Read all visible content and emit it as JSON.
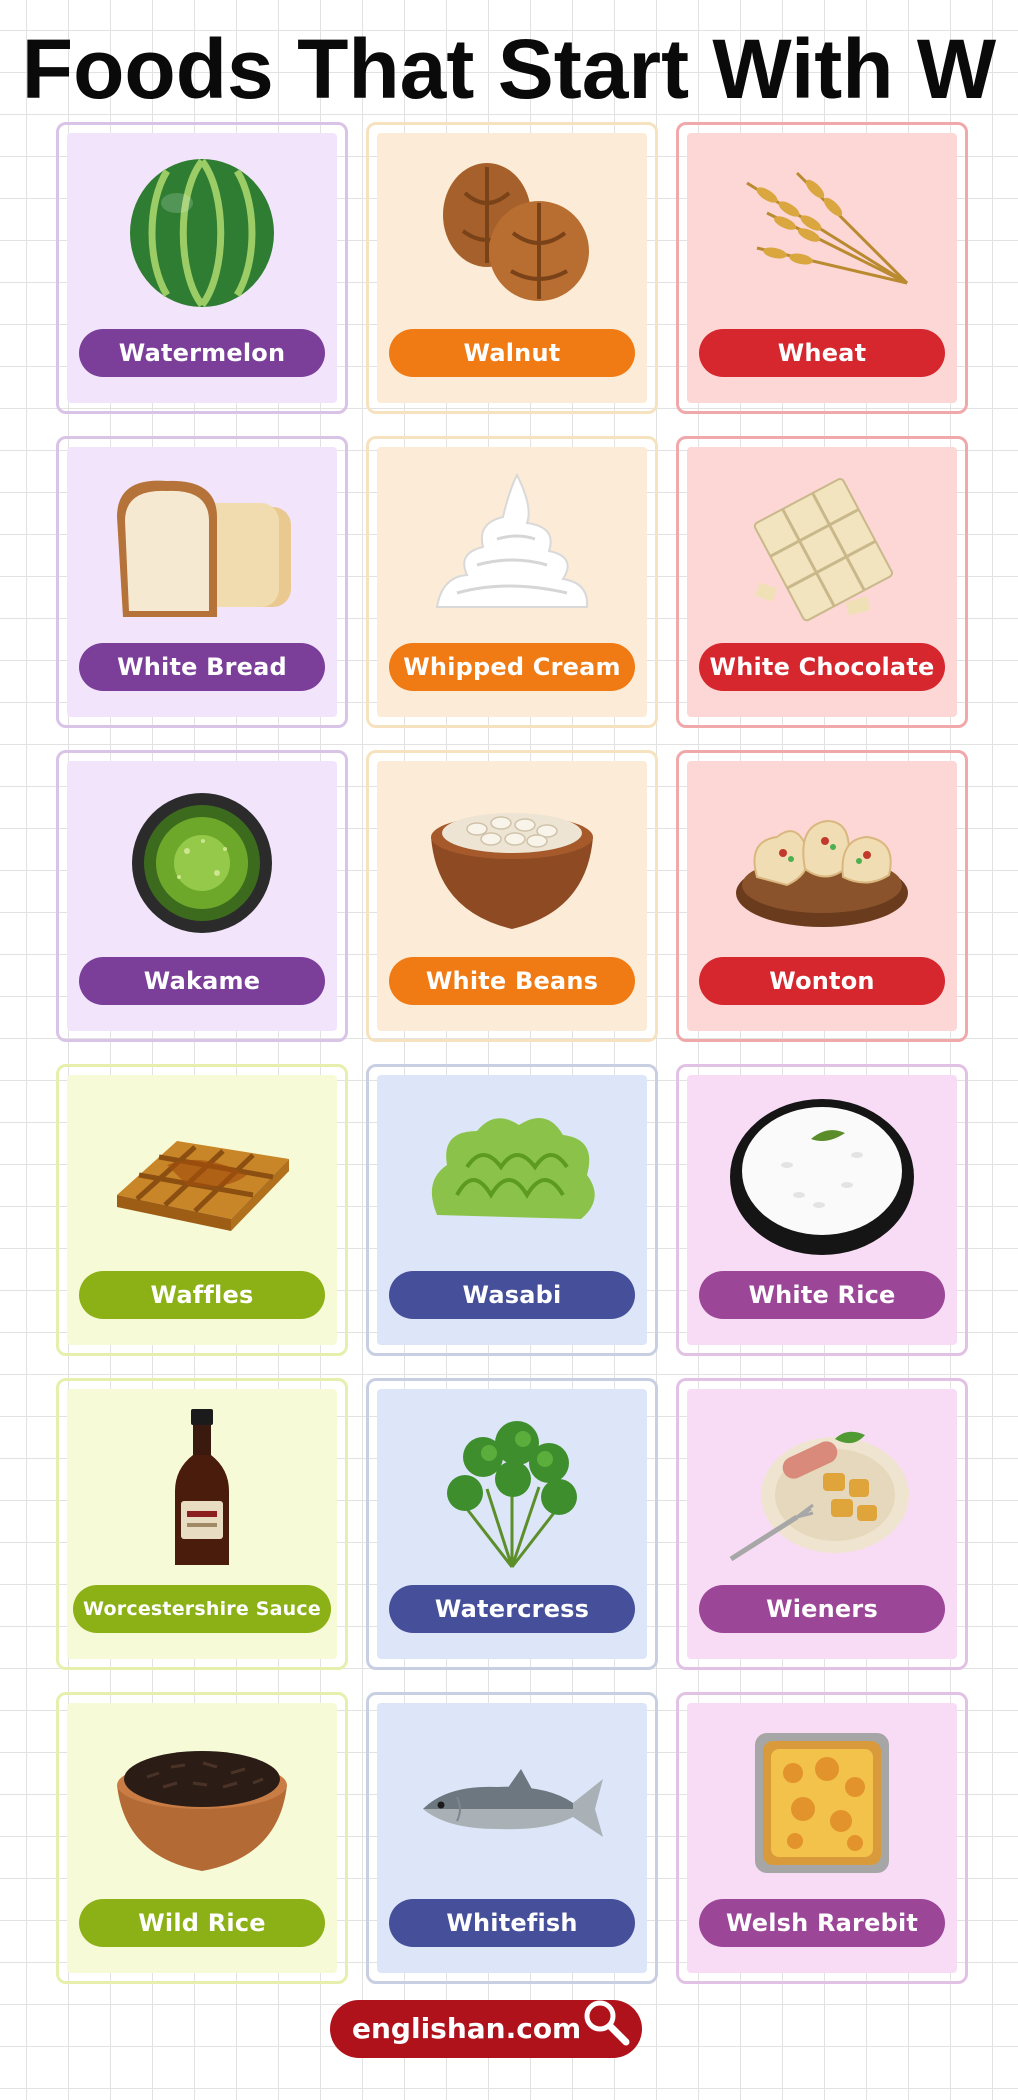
{
  "title": "Foods That Start With W",
  "cards": [
    {
      "label": "Watermelon",
      "theme": "purple",
      "icon": "watermelon-icon"
    },
    {
      "label": "Walnut",
      "theme": "orange",
      "icon": "walnut-icon"
    },
    {
      "label": "Wheat",
      "theme": "red",
      "icon": "wheat-icon"
    },
    {
      "label": "White Bread",
      "theme": "purple",
      "icon": "bread-icon"
    },
    {
      "label": "Whipped Cream",
      "theme": "orange",
      "icon": "whipped-cream-icon"
    },
    {
      "label": "White Chocolate",
      "theme": "red",
      "icon": "chocolate-icon"
    },
    {
      "label": "Wakame",
      "theme": "purple",
      "icon": "seaweed-bowl-icon"
    },
    {
      "label": "White Beans",
      "theme": "orange",
      "icon": "beans-bowl-icon"
    },
    {
      "label": "Wonton",
      "theme": "red",
      "icon": "wonton-icon"
    },
    {
      "label": "Waffles",
      "theme": "green",
      "icon": "waffle-icon"
    },
    {
      "label": "Wasabi",
      "theme": "blue",
      "icon": "wasabi-icon"
    },
    {
      "label": "White Rice",
      "theme": "pink",
      "icon": "rice-bowl-icon"
    },
    {
      "label": "Worcestershire Sauce",
      "theme": "green",
      "icon": "sauce-bottle-icon"
    },
    {
      "label": "Watercress",
      "theme": "blue",
      "icon": "watercress-icon"
    },
    {
      "label": "Wieners",
      "theme": "pink",
      "icon": "wieners-plate-icon"
    },
    {
      "label": "Wild Rice",
      "theme": "green",
      "icon": "wild-rice-bowl-icon"
    },
    {
      "label": "Whitefish",
      "theme": "blue",
      "icon": "fish-icon"
    },
    {
      "label": "Welsh Rarebit",
      "theme": "pink",
      "icon": "rarebit-toast-icon"
    }
  ],
  "footer": {
    "site": "englishan.com",
    "icon": "search-icon"
  },
  "colors": {
    "purple": "#7b3f9a",
    "orange": "#f07a13",
    "red": "#d6262e",
    "green": "#8cb116",
    "blue": "#46509a",
    "pink": "#9b4697",
    "footer": "#b0121c"
  }
}
